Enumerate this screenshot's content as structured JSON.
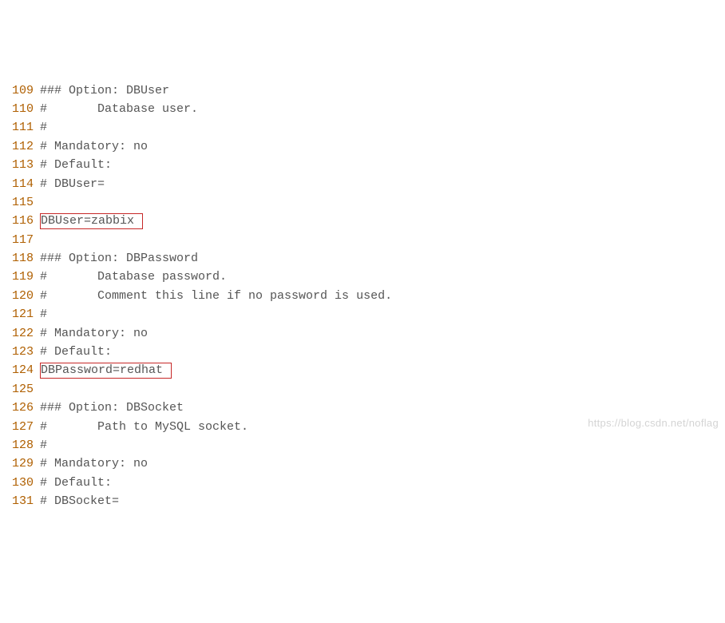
{
  "lines": [
    {
      "num": "109",
      "text": "### Option: DBUser",
      "highlight": false
    },
    {
      "num": "110",
      "text": "#       Database user.",
      "highlight": false
    },
    {
      "num": "111",
      "text": "#",
      "highlight": false
    },
    {
      "num": "112",
      "text": "# Mandatory: no",
      "highlight": false
    },
    {
      "num": "113",
      "text": "# Default:",
      "highlight": false
    },
    {
      "num": "114",
      "text": "# DBUser=",
      "highlight": false
    },
    {
      "num": "115",
      "text": "",
      "highlight": false
    },
    {
      "num": "116",
      "text": "DBUser=zabbix ",
      "highlight": true
    },
    {
      "num": "117",
      "text": "",
      "highlight": false
    },
    {
      "num": "118",
      "text": "### Option: DBPassword",
      "highlight": false
    },
    {
      "num": "119",
      "text": "#       Database password.",
      "highlight": false
    },
    {
      "num": "120",
      "text": "#       Comment this line if no password is used.",
      "highlight": false
    },
    {
      "num": "121",
      "text": "#",
      "highlight": false
    },
    {
      "num": "122",
      "text": "# Mandatory: no",
      "highlight": false
    },
    {
      "num": "123",
      "text": "# Default:",
      "highlight": false
    },
    {
      "num": "124",
      "text": "DBPassword=redhat ",
      "highlight": true
    },
    {
      "num": "125",
      "text": "",
      "highlight": false
    },
    {
      "num": "126",
      "text": "### Option: DBSocket",
      "highlight": false
    },
    {
      "num": "127",
      "text": "#       Path to MySQL socket.",
      "highlight": false
    },
    {
      "num": "128",
      "text": "#",
      "highlight": false
    },
    {
      "num": "129",
      "text": "# Mandatory: no",
      "highlight": false
    },
    {
      "num": "130",
      "text": "# Default:",
      "highlight": false
    },
    {
      "num": "131",
      "text": "# DBSocket=",
      "highlight": false
    }
  ],
  "watermark": "https://blog.csdn.net/noflag"
}
